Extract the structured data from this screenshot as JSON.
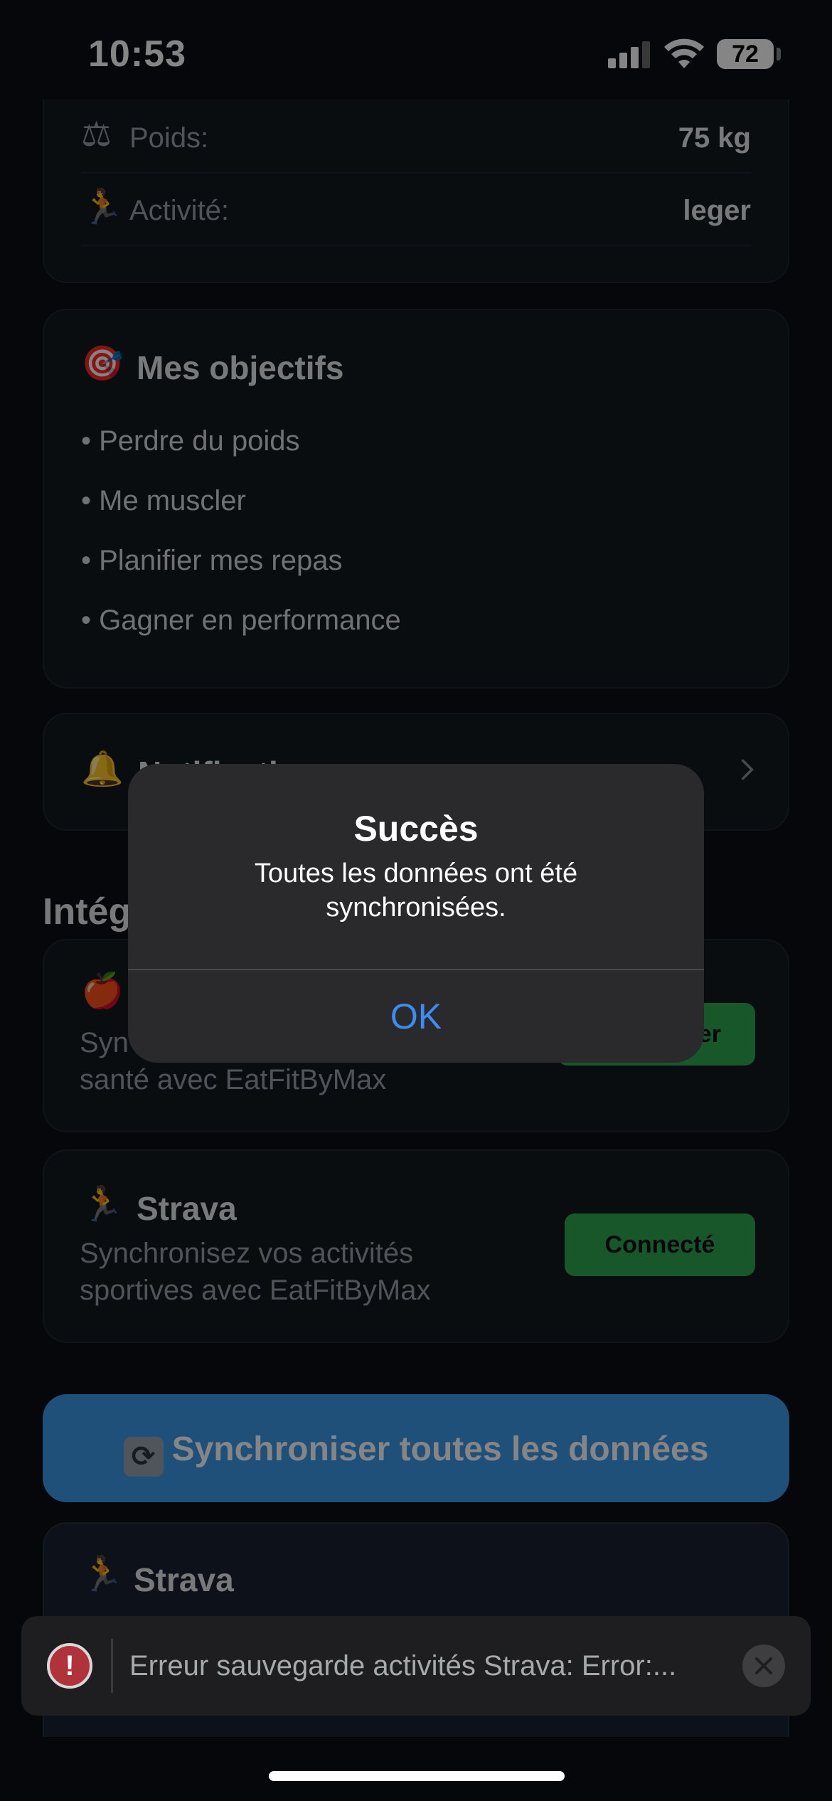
{
  "status": {
    "time": "10:53",
    "battery": "72"
  },
  "profile": {
    "weight": {
      "icon": "scales-icon",
      "label": "Poids:",
      "value": "75 kg"
    },
    "activity": {
      "icon": "runner-icon",
      "label": "Activité:",
      "value": "leger"
    }
  },
  "goals": {
    "icon": "target-icon",
    "title": "Mes objectifs",
    "items": [
      "• Perdre du poids",
      "• Me muscler",
      "• Planifier mes repas",
      "• Gagner en performance"
    ]
  },
  "notifications": {
    "icon": "bell-icon",
    "label": "Notificati"
  },
  "integrations": {
    "title": "Intég",
    "apple_health": {
      "icon": "apple-icon",
      "desc_line1": "Syn",
      "desc_line2": "santé avec EatFitByMax",
      "button": "er"
    },
    "strava": {
      "icon": "runner-icon",
      "title": "Strava",
      "desc_line1": "Synchronisez vos activités",
      "desc_line2": "sportives avec EatFitByMax",
      "button": "Connecté"
    }
  },
  "sync_button": {
    "icon": "sync-icon",
    "label": "Synchroniser toutes les données"
  },
  "strava_section": {
    "icon": "runner-icon",
    "title": "Strava"
  },
  "toast": {
    "message": "Erreur sauvegarde activités Strava: Error:..."
  },
  "alert": {
    "title": "Succès",
    "message": "Toutes les données ont été synchronisées.",
    "ok": "OK"
  },
  "colors": {
    "accent_blue": "#3a9ae8",
    "success_green": "#2ea84f",
    "error_red": "#b0323a",
    "alert_link": "#3b8cf6"
  }
}
